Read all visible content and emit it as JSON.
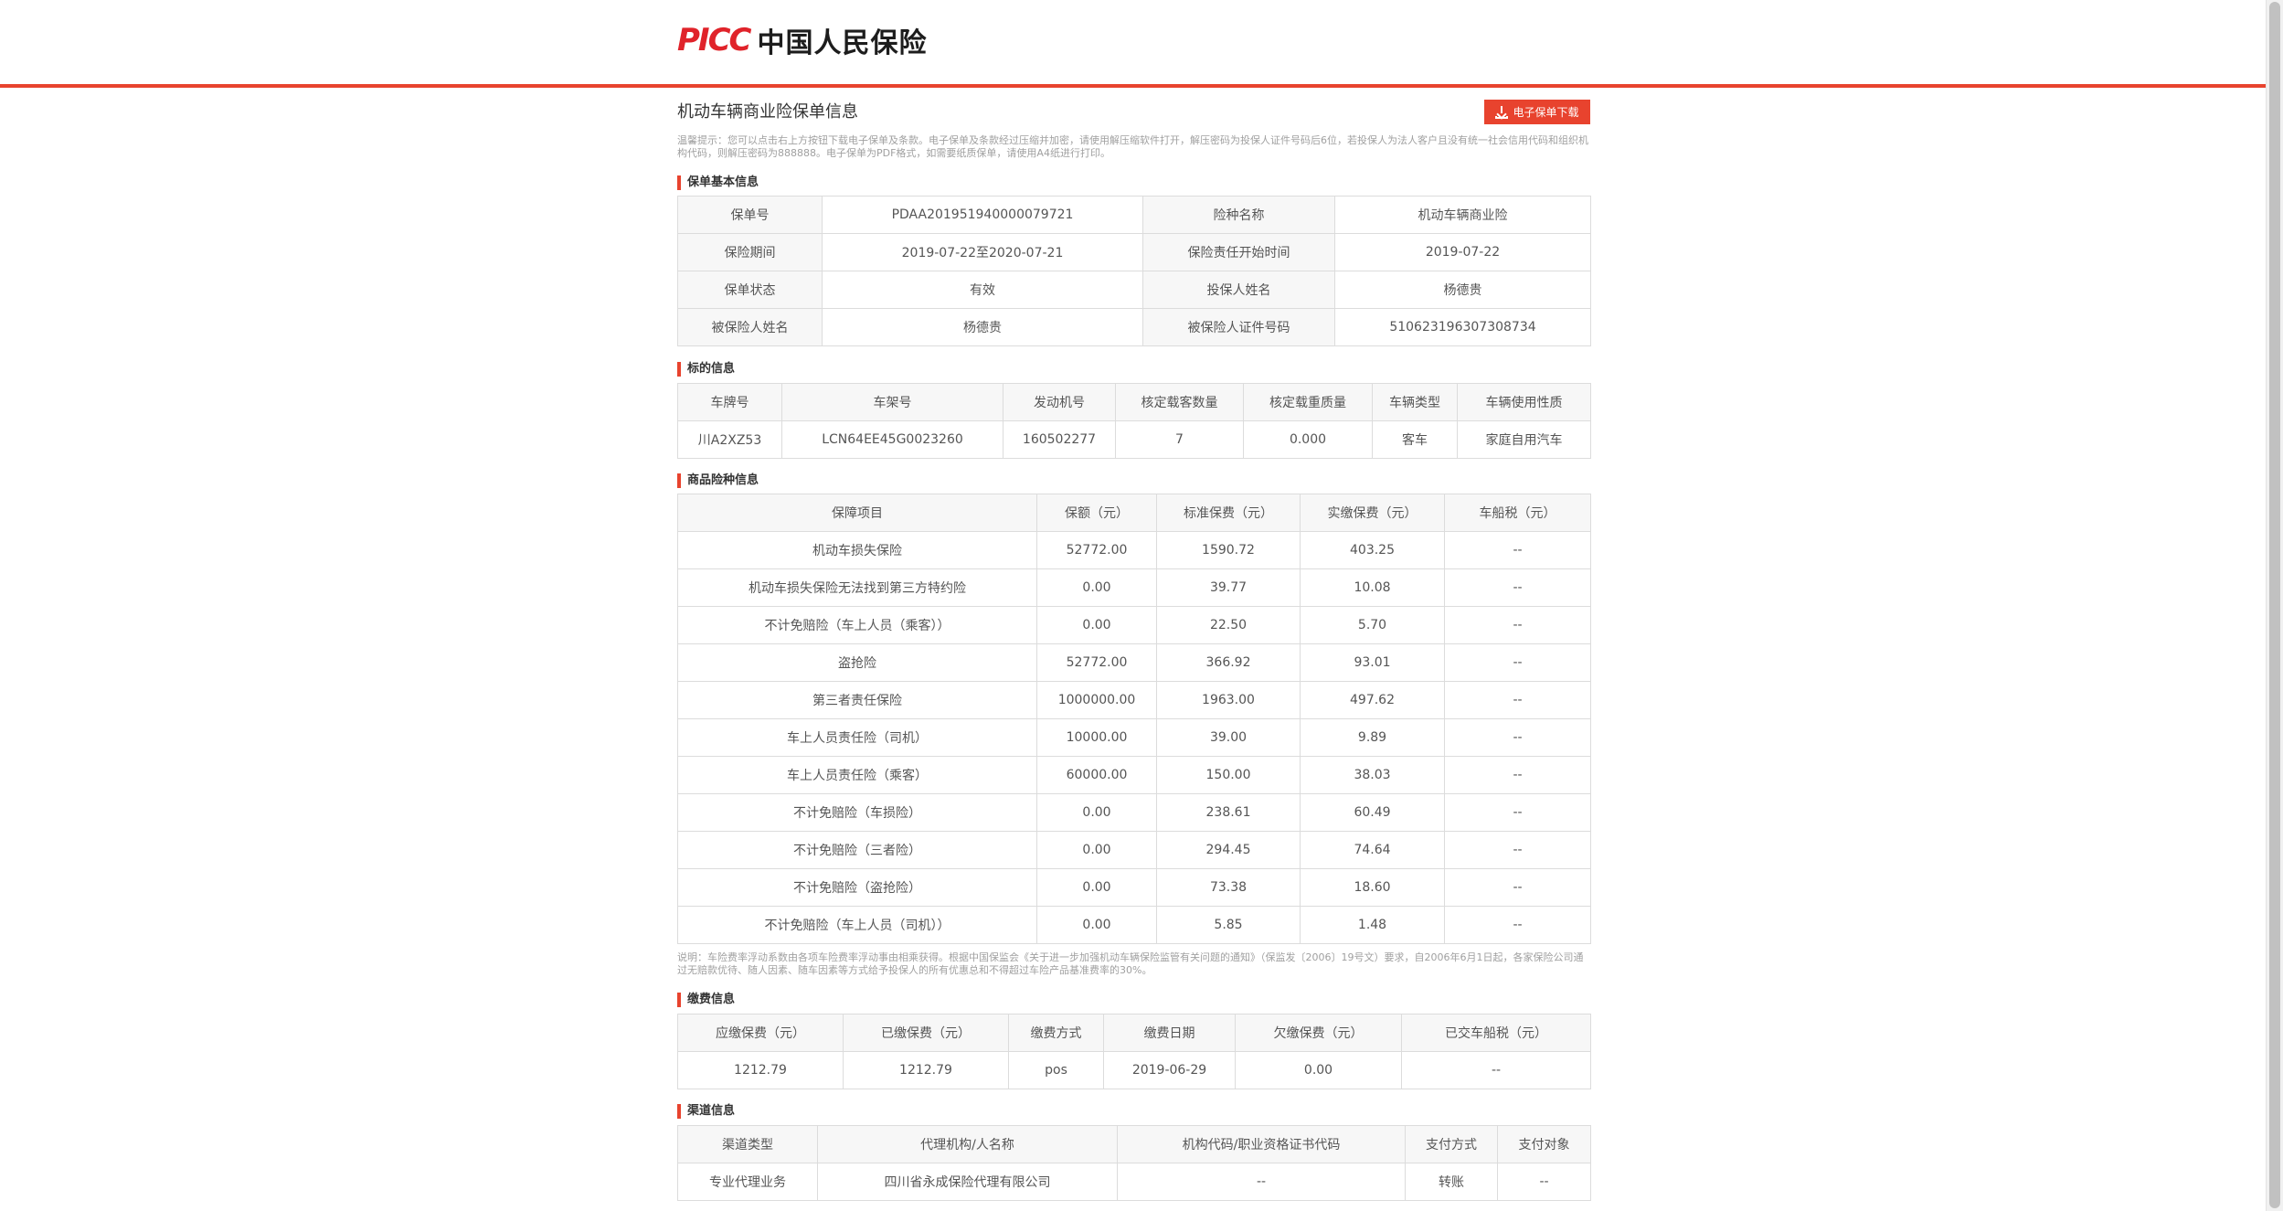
{
  "header": {
    "logo_en": "PICC",
    "logo_cn": "中国人民保险",
    "accent_color": "#e8432e"
  },
  "page": {
    "title": "机动车辆商业险保单信息",
    "download_label": "电子保单下载",
    "download_icon": "download-icon",
    "tip": "温馨提示：您可以点击右上方按钮下载电子保单及条款。电子保单及条款经过压缩并加密，请使用解压缩软件打开，解压密码为投保人证件号码后6位，若投保人为法人客户且没有统一社会信用代码和组织机构代码，则解压密码为888888。电子保单为PDF格式，如需要纸质保单，请使用A4纸进行打印。"
  },
  "basic": {
    "title": "保单基本信息",
    "rows": [
      [
        "保单号",
        "PDAA201951940000079721",
        "险种名称",
        "机动车辆商业险"
      ],
      [
        "保险期间",
        "2019-07-22至2020-07-21",
        "保险责任开始时间",
        "2019-07-22"
      ],
      [
        "保单状态",
        "有效",
        "投保人姓名",
        "杨德贵"
      ],
      [
        "被保险人姓名",
        "杨德贵",
        "被保险人证件号码",
        "510623196307308734"
      ]
    ]
  },
  "subject": {
    "title": "标的信息",
    "headers": [
      "车牌号",
      "车架号",
      "发动机号",
      "核定载客数量",
      "核定载重质量",
      "车辆类型",
      "车辆使用性质"
    ],
    "row": [
      "川A2XZ53",
      "LCN64EE45G0023260",
      "160502277",
      "7",
      "0.000",
      "客车",
      "家庭自用汽车"
    ]
  },
  "products": {
    "title": "商品险种信息",
    "headers": [
      "保障项目",
      "保额（元）",
      "标准保费（元）",
      "实缴保费（元）",
      "车船税（元）"
    ],
    "rows": [
      [
        "机动车损失保险",
        "52772.00",
        "1590.72",
        "403.25",
        "--"
      ],
      [
        "机动车损失保险无法找到第三方特约险",
        "0.00",
        "39.77",
        "10.08",
        "--"
      ],
      [
        "不计免赔险（车上人员（乘客））",
        "0.00",
        "22.50",
        "5.70",
        "--"
      ],
      [
        "盗抢险",
        "52772.00",
        "366.92",
        "93.01",
        "--"
      ],
      [
        "第三者责任保险",
        "1000000.00",
        "1963.00",
        "497.62",
        "--"
      ],
      [
        "车上人员责任险（司机）",
        "10000.00",
        "39.00",
        "9.89",
        "--"
      ],
      [
        "车上人员责任险（乘客）",
        "60000.00",
        "150.00",
        "38.03",
        "--"
      ],
      [
        "不计免赔险（车损险）",
        "0.00",
        "238.61",
        "60.49",
        "--"
      ],
      [
        "不计免赔险（三者险）",
        "0.00",
        "294.45",
        "74.64",
        "--"
      ],
      [
        "不计免赔险（盗抢险）",
        "0.00",
        "73.38",
        "18.60",
        "--"
      ],
      [
        "不计免赔险（车上人员（司机））",
        "0.00",
        "5.85",
        "1.48",
        "--"
      ]
    ],
    "note": "说明：车险费率浮动系数由各项车险费率浮动事由相乘获得。根据中国保监会《关于进一步加强机动车辆保险监管有关问题的通知》（保监发〔2006〕19号文）要求，自2006年6月1日起，各家保险公司通过无赔款优待、随人因素、随车因素等方式给予投保人的所有优惠总和不得超过车险产品基准费率的30%。"
  },
  "payment": {
    "title": "缴费信息",
    "headers": [
      "应缴保费（元）",
      "已缴保费（元）",
      "缴费方式",
      "缴费日期",
      "欠缴保费（元）",
      "已交车船税（元）"
    ],
    "row": [
      "1212.79",
      "1212.79",
      "pos",
      "2019-06-29",
      "0.00",
      "--"
    ]
  },
  "channel": {
    "title": "渠道信息",
    "headers": [
      "渠道类型",
      "代理机构/人名称",
      "机构代码/职业资格证书代码",
      "支付方式",
      "支付对象"
    ],
    "row": [
      "专业代理业务",
      "四川省永成保险代理有限公司",
      "--",
      "转账",
      "--"
    ]
  }
}
